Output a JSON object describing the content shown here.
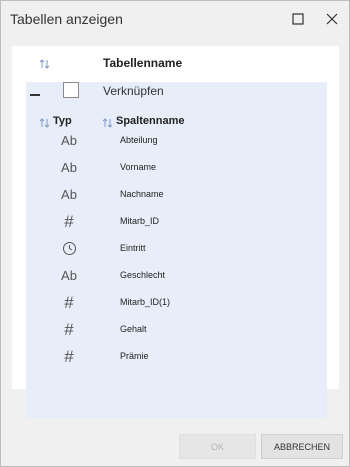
{
  "dialog": {
    "title": "Tabellen anzeigen",
    "icons": {
      "maximize": "maximize-icon",
      "close": "close-icon"
    }
  },
  "table_header": {
    "title": "Tabellenname",
    "sort_icon": "sort-icon"
  },
  "group": {
    "label": "Verknüpfen",
    "expanded": true,
    "checked": false,
    "columns": {
      "type": "Typ",
      "name": "Spaltenname"
    },
    "rows": [
      {
        "type_symbol": "Ab",
        "type_icon": "text-type-icon",
        "name": "Abteilung"
      },
      {
        "type_symbol": "Ab",
        "type_icon": "text-type-icon",
        "name": "Vorname"
      },
      {
        "type_symbol": "Ab",
        "type_icon": "text-type-icon",
        "name": "Nachname"
      },
      {
        "type_symbol": "#",
        "type_icon": "number-type-icon",
        "name": "Mitarb_ID"
      },
      {
        "type_symbol": "",
        "type_icon": "clock-type-icon",
        "name": "Eintritt"
      },
      {
        "type_symbol": "Ab",
        "type_icon": "text-type-icon",
        "name": "Geschlecht"
      },
      {
        "type_symbol": "#",
        "type_icon": "number-type-icon",
        "name": "Mitarb_ID(1)"
      },
      {
        "type_symbol": "#",
        "type_icon": "number-type-icon",
        "name": "Gehalt"
      },
      {
        "type_symbol": "#",
        "type_icon": "number-type-icon",
        "name": "Prämie"
      }
    ]
  },
  "buttons": {
    "ok": "OK",
    "cancel": "ABBRECHEN",
    "ok_enabled": false
  },
  "colors": {
    "group_bg": "#e8eef9",
    "sort_icon": "#7a9cc8",
    "panel_bg": "#ffffff",
    "dialog_bg": "#f0f0f0"
  }
}
